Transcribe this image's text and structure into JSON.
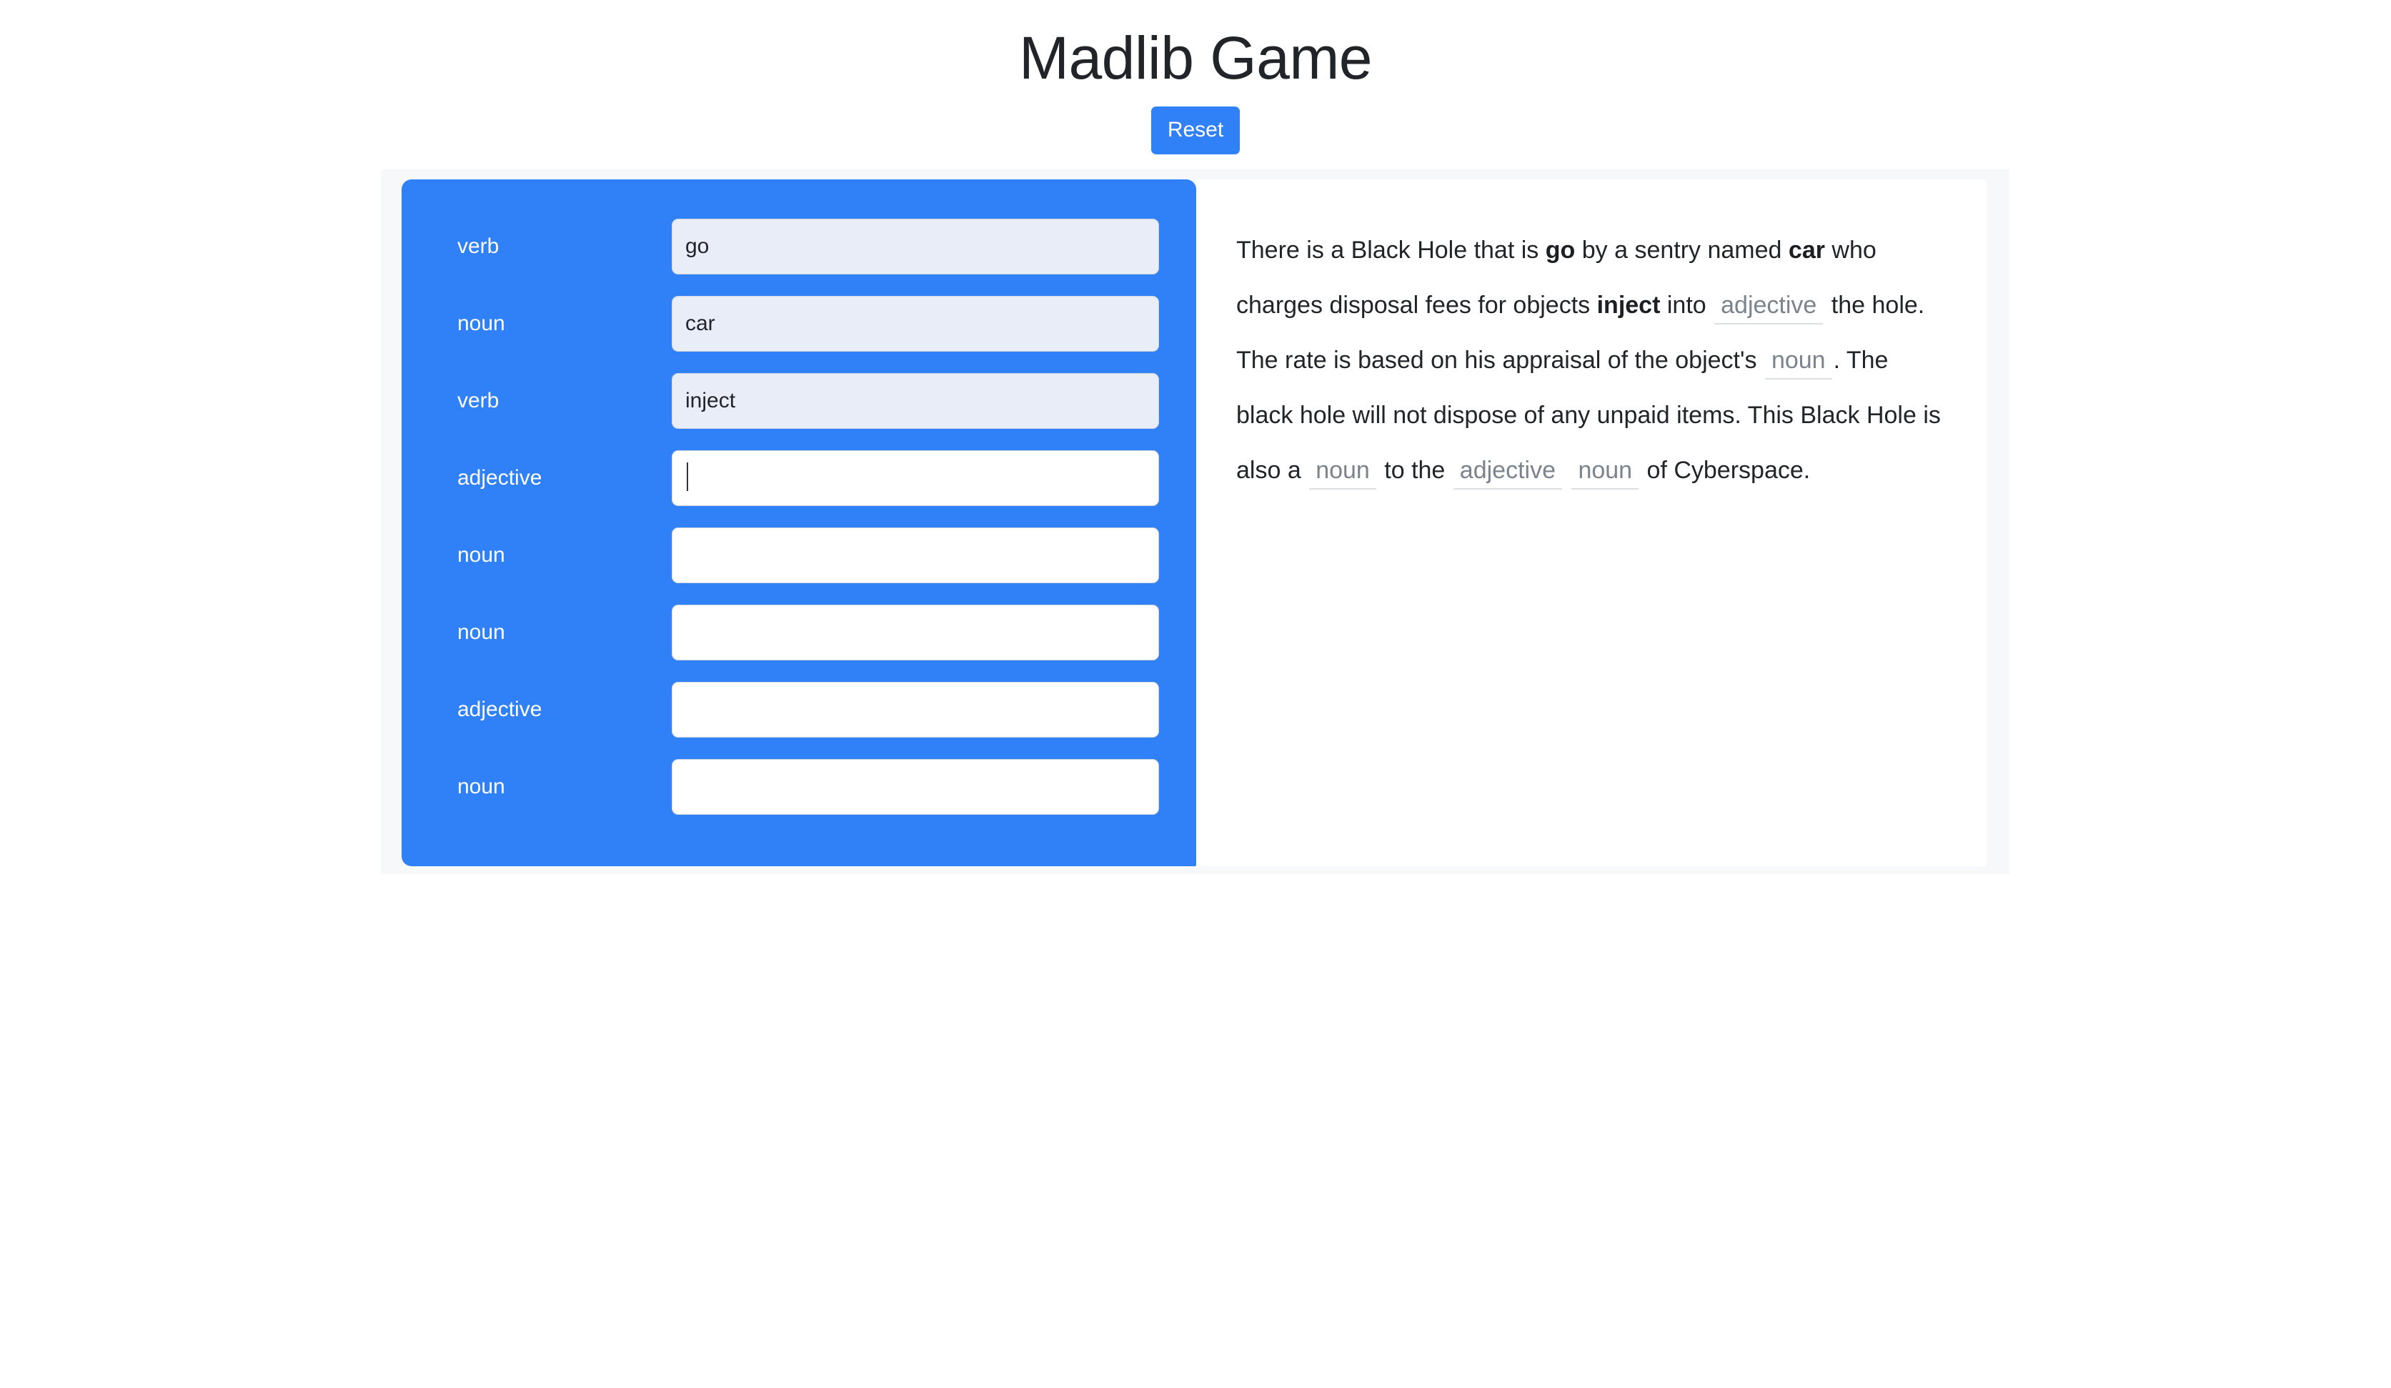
{
  "header": {
    "title": "Madlib Game",
    "reset_label": "Reset"
  },
  "theme": {
    "accent": "#3080f8",
    "panel_bg": "#f7f8fa",
    "filled_input_bg": "#e9edf8",
    "blank_text": "#7b848c",
    "body_text": "#212529"
  },
  "form": {
    "fields": [
      {
        "label": "verb",
        "value": "go",
        "placeholder": "",
        "filled": true,
        "focused": false
      },
      {
        "label": "noun",
        "value": "car",
        "placeholder": "",
        "filled": true,
        "focused": false
      },
      {
        "label": "verb",
        "value": "inject",
        "placeholder": "",
        "filled": true,
        "focused": false
      },
      {
        "label": "adjective",
        "value": "",
        "placeholder": "",
        "filled": false,
        "focused": true
      },
      {
        "label": "noun",
        "value": "",
        "placeholder": "",
        "filled": false,
        "focused": false
      },
      {
        "label": "noun",
        "value": "",
        "placeholder": "",
        "filled": false,
        "focused": false
      },
      {
        "label": "adjective",
        "value": "",
        "placeholder": "",
        "filled": false,
        "focused": false
      },
      {
        "label": "noun",
        "value": "",
        "placeholder": "",
        "filled": false,
        "focused": false
      }
    ]
  },
  "story": {
    "segments": [
      {
        "type": "text",
        "text": "There is a Black Hole that is "
      },
      {
        "type": "value",
        "text": "go"
      },
      {
        "type": "text",
        "text": " by a sentry named "
      },
      {
        "type": "value",
        "text": "car"
      },
      {
        "type": "text",
        "text": " who charges disposal fees for objects "
      },
      {
        "type": "value",
        "text": "inject"
      },
      {
        "type": "text",
        "text": " into "
      },
      {
        "type": "blank",
        "text": "adjective"
      },
      {
        "type": "text",
        "text": " the hole. The rate is based on his appraisal of the object's "
      },
      {
        "type": "blank",
        "text": "noun"
      },
      {
        "type": "text",
        "text": ". The black hole will not dispose of any unpaid items. This Black Hole is also a "
      },
      {
        "type": "blank",
        "text": "noun"
      },
      {
        "type": "text",
        "text": " to the "
      },
      {
        "type": "blank",
        "text": "adjective"
      },
      {
        "type": "text",
        "text": " "
      },
      {
        "type": "blank",
        "text": "noun"
      },
      {
        "type": "text",
        "text": " of Cyberspace."
      }
    ]
  }
}
